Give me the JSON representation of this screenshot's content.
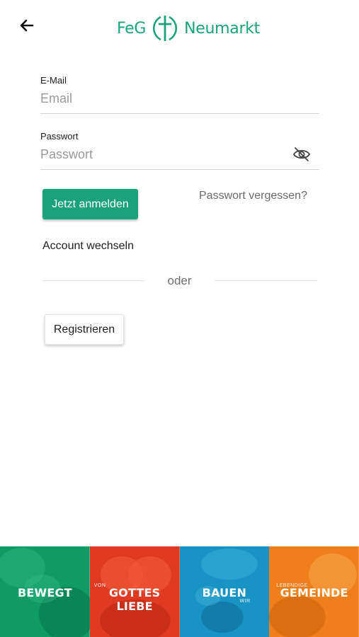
{
  "header": {
    "back_icon": "arrow-left-icon",
    "logo_left": "FeG",
    "logo_right": "Neumarkt",
    "brand_color": "#1aa37a"
  },
  "login": {
    "email_label": "E-Mail",
    "email_placeholder": "Email",
    "email_value": "",
    "password_label": "Passwort",
    "password_placeholder": "Passwort",
    "password_value": "",
    "password_toggle_icon": "eye-off-icon",
    "submit_label": "Jetzt anmelden",
    "forgot_label": "Passwort vergessen?",
    "switch_account_label": "Account wechseln",
    "divider_label": "oder",
    "register_label": "Registrieren"
  },
  "banner": {
    "tiles": [
      {
        "small": "",
        "main": "BEWEGT",
        "sub": "",
        "color": "#14a06c"
      },
      {
        "small": "VON",
        "main": "GOTTES LIEBE",
        "sub": "",
        "color": "#e2391f"
      },
      {
        "small": "",
        "main": "BAUEN",
        "sub": "WIR",
        "color": "#1895c6"
      },
      {
        "small": "LEBENDIGE",
        "main": "GEMEINDE",
        "sub": "",
        "color": "#f0801c"
      }
    ]
  }
}
